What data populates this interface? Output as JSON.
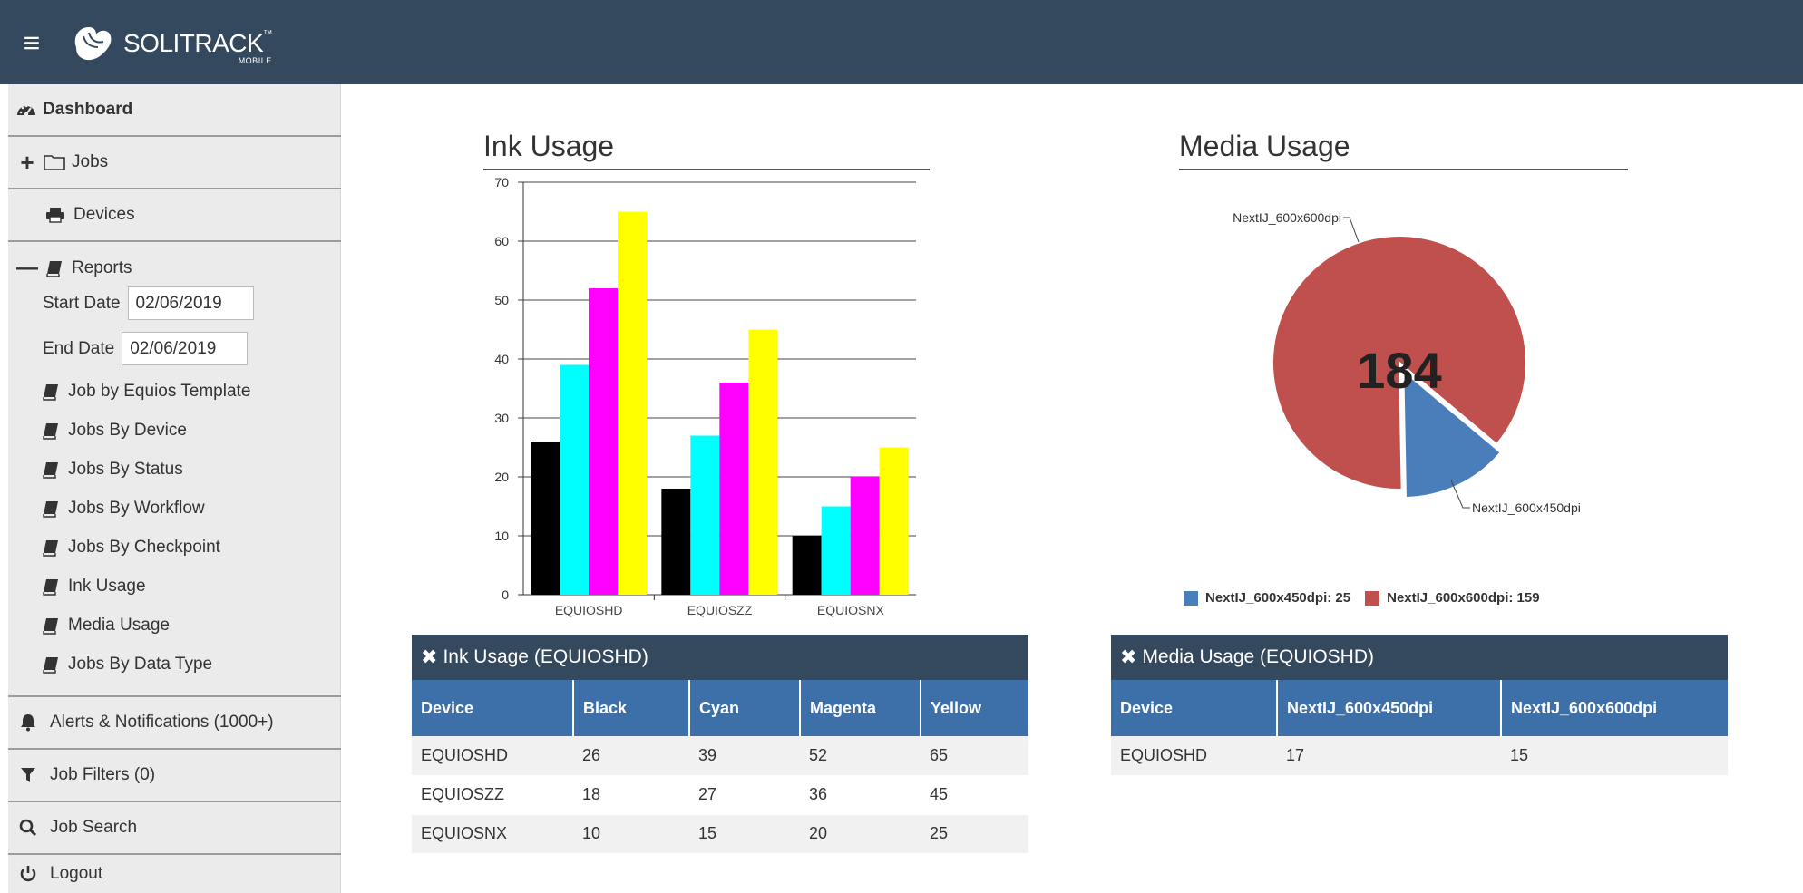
{
  "header": {
    "menu_icon": "hamburger-icon",
    "logo_text": "SOLITRACK",
    "logo_tm": "™",
    "logo_sub": "MOBILE"
  },
  "sidebar": {
    "dashboard": "Dashboard",
    "jobs": "Jobs",
    "devices": "Devices",
    "reports": "Reports",
    "start_date_label": "Start Date",
    "start_date_value": "02/06/2019",
    "end_date_label": "End Date",
    "end_date_value": "02/06/2019",
    "report_items": [
      "Job by Equios Template",
      "Jobs By Device",
      "Jobs By Status",
      "Jobs By Workflow",
      "Jobs By Checkpoint",
      "Ink Usage",
      "Media Usage",
      "Jobs By Data Type"
    ],
    "alerts": "Alerts & Notifications (1000+)",
    "job_filters": "Job Filters (0)",
    "job_search": "Job Search",
    "logout": "Logout"
  },
  "ink_chart": {
    "title": "Ink Usage"
  },
  "media_chart": {
    "title": "Media Usage",
    "center_total": "184",
    "callout_a": "NextIJ_600x600dpi",
    "callout_b": "NextIJ_600x450dpi",
    "legend": [
      {
        "label": "NextIJ_600x450dpi: 25",
        "color": "#4a7ebb"
      },
      {
        "label": "NextIJ_600x600dpi: 159",
        "color": "#c0504d"
      }
    ]
  },
  "chart_data": [
    {
      "type": "bar",
      "title": "Ink Usage",
      "categories": [
        "EQUIOSHD",
        "EQUIOSZZ",
        "EQUIOSNX"
      ],
      "series": [
        {
          "values": [
            26,
            18,
            10
          ],
          "color": "#000000"
        },
        {
          "values": [
            39,
            27,
            15
          ],
          "color": "#00ffff"
        },
        {
          "values": [
            52,
            36,
            20
          ],
          "color": "#ff00ff"
        },
        {
          "values": [
            65,
            45,
            25
          ],
          "color": "#ffff00"
        }
      ],
      "ylim": [
        0,
        70
      ],
      "yticks": [
        0,
        10,
        20,
        30,
        40,
        50,
        60,
        70
      ],
      "grid": true
    },
    {
      "type": "pie",
      "title": "Media Usage",
      "labels": [
        "NextIJ_600x450dpi",
        "NextIJ_600x600dpi"
      ],
      "values": [
        25,
        159
      ],
      "colors": [
        "#4a7ebb",
        "#c0504d"
      ],
      "center_label": "184"
    }
  ],
  "ink_table": {
    "title": "Ink Usage (EQUIOSHD)",
    "columns": [
      "Device",
      "Black",
      "Cyan",
      "Magenta",
      "Yellow"
    ],
    "rows": [
      [
        "EQUIOSHD",
        "26",
        "39",
        "52",
        "65"
      ],
      [
        "EQUIOSZZ",
        "18",
        "27",
        "36",
        "45"
      ],
      [
        "EQUIOSNX",
        "10",
        "15",
        "20",
        "25"
      ]
    ]
  },
  "media_table": {
    "title": "Media Usage (EQUIOSHD)",
    "columns": [
      "Device",
      "NextIJ_600x450dpi",
      "NextIJ_600x600dpi"
    ],
    "rows": [
      [
        "EQUIOSHD",
        "17",
        "15"
      ]
    ]
  }
}
